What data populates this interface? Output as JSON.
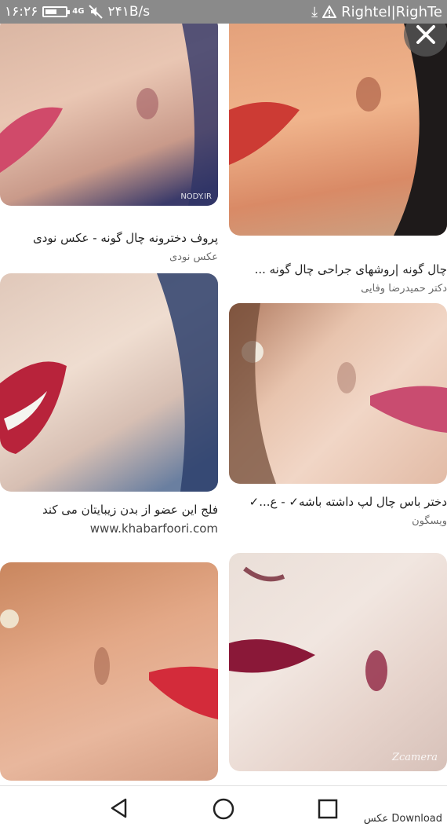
{
  "status_bar": {
    "time": "۱۶:۲۶",
    "network": "4G",
    "speed": "۲۴۱B/s",
    "carrier": "Rightel|RighTe",
    "icons": [
      "battery-icon",
      "signal-icon",
      "mute-icon",
      "download-icon",
      "warning-icon"
    ]
  },
  "close_button": {
    "icon": "close-icon"
  },
  "results": [
    {
      "title": "پروف دخترونه چال گونه - عکس نودی",
      "source": "عکس نودی",
      "watermark": "NODY.IR"
    },
    {
      "title": "چال گونه |روشهای جراحی چال گونه ...",
      "source": "دکتر حمیدرضا وفایی"
    },
    {
      "title": "فلج این عضو از بدن زیبایتان می کند",
      "source": "www.khabarfoori.com"
    },
    {
      "title": "دختر باس چال لپ داشته باشه✓ - ع...✓",
      "source": "ویسگون"
    },
    {
      "title": "",
      "source": ""
    },
    {
      "title": "",
      "source": "",
      "watermark": "Zcamera"
    }
  ],
  "nav_bar": {
    "icons": [
      "back-icon",
      "home-icon",
      "recents-icon"
    ],
    "brand": "Download عکس"
  }
}
